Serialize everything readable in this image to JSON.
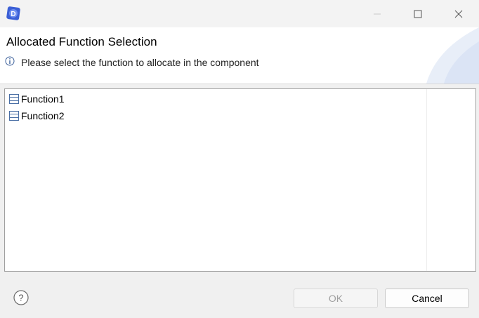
{
  "window": {
    "minimize_icon": "minimize-icon",
    "maximize_icon": "maximize-icon",
    "close_icon": "close-icon",
    "app_icon": "app-logo-icon"
  },
  "header": {
    "title": "Allocated Function Selection",
    "message": "Please select the function to allocate in the component",
    "message_icon": "info-icon"
  },
  "list": {
    "items": [
      {
        "label": "Function1",
        "icon": "function-icon"
      },
      {
        "label": "Function2",
        "icon": "function-icon"
      }
    ]
  },
  "footer": {
    "help_icon": "help-icon",
    "ok_label": "OK",
    "cancel_label": "Cancel"
  },
  "colors": {
    "accent": "#3b5fd6",
    "icon_blue": "#4a6fa5"
  }
}
